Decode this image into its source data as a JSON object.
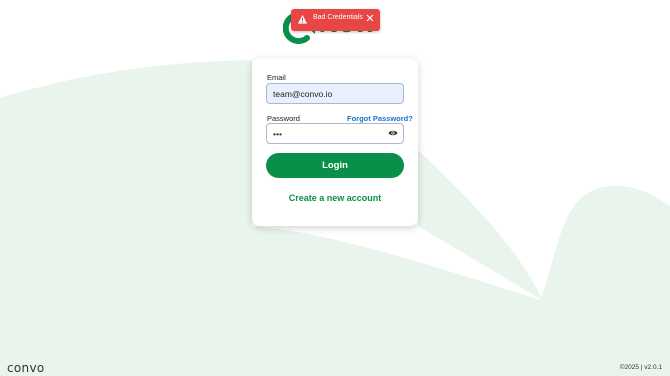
{
  "brand": {
    "logo_text": "Now",
    "accent_color": "#0a8f4a",
    "footer_logo": "convo"
  },
  "toast": {
    "message": "Bad Credentials",
    "icon": "warning-icon",
    "close_icon": "close-icon",
    "color": "#e84545"
  },
  "login_form": {
    "email_label": "Email",
    "email_value": "team@convo.io",
    "password_label": "Password",
    "forgot_password": "Forgot Password?",
    "password_value": "•••",
    "show_password_icon": "eye-icon",
    "login_button": "Login",
    "create_account": "Create a new account"
  },
  "footer": {
    "copyright_version": "©2025 | v2.0.1"
  }
}
